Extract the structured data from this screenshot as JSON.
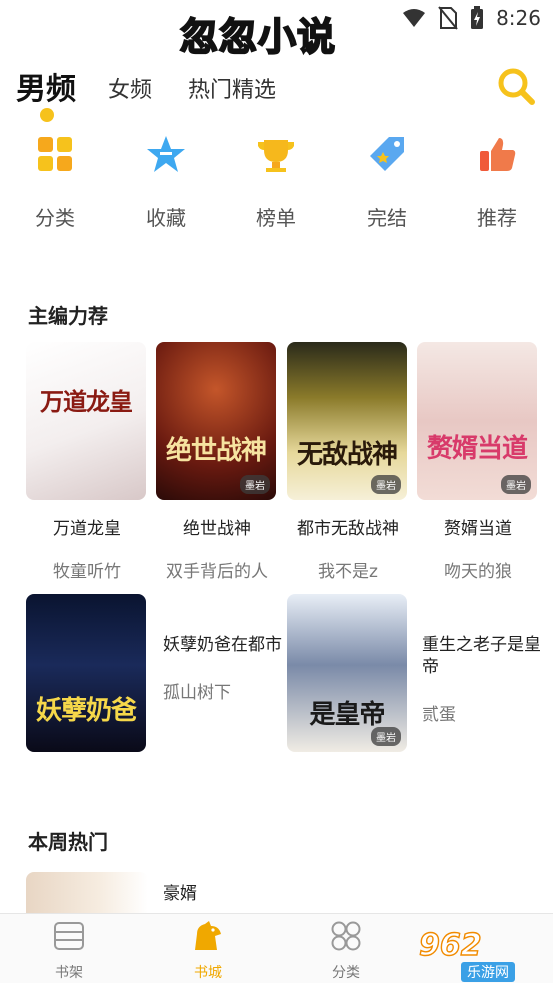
{
  "status_bar": {
    "watermark": "忽忽小说",
    "time": "8:26",
    "icons": [
      "wifi-icon",
      "no-sim-icon",
      "battery-charging-icon"
    ]
  },
  "top_tabs": {
    "tabs": [
      {
        "label": "男频",
        "active": true
      },
      {
        "label": "女频",
        "active": false
      },
      {
        "label": "热门精选",
        "active": false
      }
    ],
    "search_icon": "search-icon"
  },
  "categories": [
    {
      "label": "分类",
      "icon": "grid-icon"
    },
    {
      "label": "收藏",
      "icon": "star-icon"
    },
    {
      "label": "榜单",
      "icon": "trophy-icon"
    },
    {
      "label": "完结",
      "icon": "tag-icon"
    },
    {
      "label": "推荐",
      "icon": "thumbs-up-icon"
    }
  ],
  "editor_picks": {
    "title": "主编力荐",
    "row1": [
      {
        "title": "万道龙皇",
        "author": "牧童听竹",
        "cover_text": "万道龙皇"
      },
      {
        "title": "绝世战神",
        "author": "双手背后的人",
        "cover_text": "绝世战神"
      },
      {
        "title": "都市无敌战神",
        "author": "我不是z",
        "cover_text": "无敌战神"
      },
      {
        "title": "赘婿当道",
        "author": "吻天的狼",
        "cover_text": "赘婿当道"
      }
    ],
    "row2": [
      {
        "title": "妖孽奶爸在都市",
        "author": "孤山树下",
        "cover_text": "妖孽奶爸"
      },
      {
        "title": "重生之老子是皇帝",
        "author": "贰蛋",
        "cover_text": "是皇帝"
      }
    ],
    "cover_badge": "墨岩"
  },
  "weekly_hot": {
    "title": "本周热门",
    "first_title": "豪婿"
  },
  "bottom_nav": [
    {
      "label": "书架",
      "icon": "bookshelf-icon",
      "active": false
    },
    {
      "label": "书城",
      "icon": "bookstore-icon",
      "active": true
    },
    {
      "label": "分类",
      "icon": "category-icon",
      "active": false
    }
  ],
  "brand_logo": {
    "big": "962",
    "small": "乐游网"
  },
  "colors": {
    "accent": "#f6c21c",
    "active_nav": "#f0a800"
  }
}
